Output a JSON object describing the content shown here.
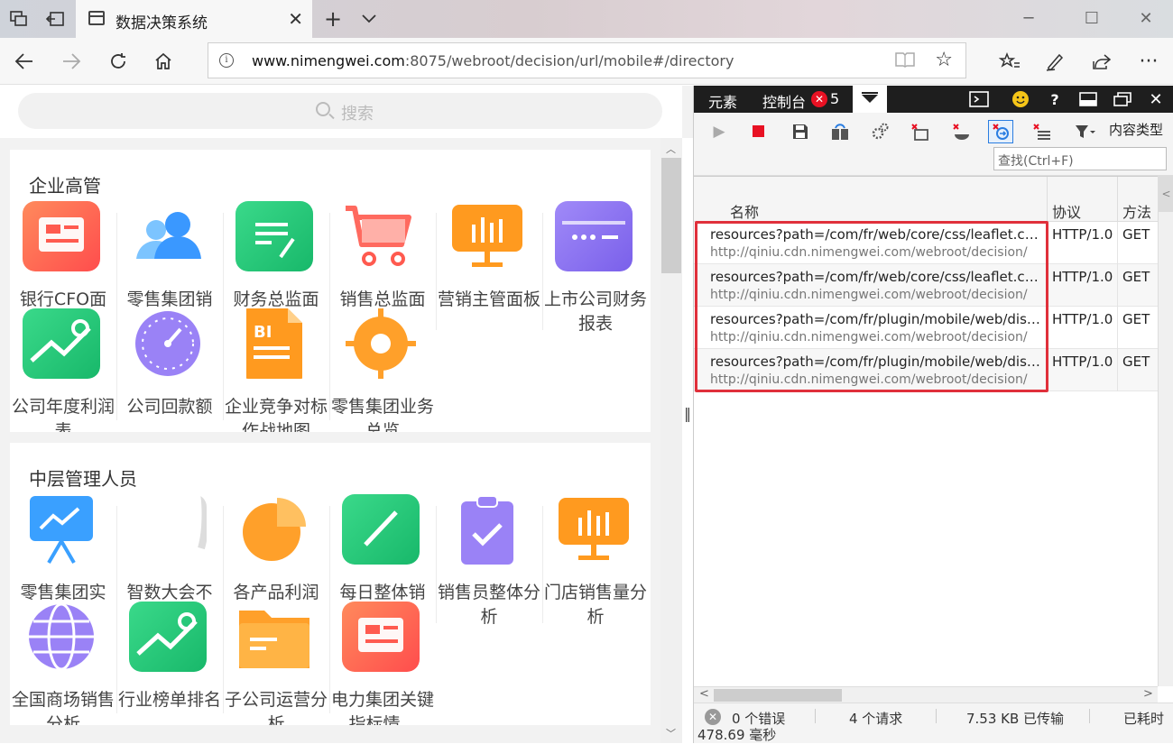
{
  "browser": {
    "tab_title": "数据决策系统",
    "url_host": "www.nimengwei.com",
    "url_rest": ":8075/webroot/decision/url/mobile#/directory"
  },
  "web": {
    "search_placeholder": "搜索",
    "sections": [
      {
        "title": "企业高管",
        "apps": [
          {
            "label": "银行CFO面",
            "icon": "id-card-icon",
            "color": "#ff6a4d"
          },
          {
            "label": "零售集团销",
            "icon": "users-icon",
            "color": "#3aa0ff"
          },
          {
            "label": "财务总监面",
            "icon": "document-edit-icon",
            "color": "#27c67a"
          },
          {
            "label": "销售总监面",
            "icon": "shopping-cart-icon",
            "color": "#ff5a4f"
          },
          {
            "label": "营销主管面板",
            "icon": "presentation-chart-icon",
            "color": "#ff9a1f"
          },
          {
            "label": "上市公司财务报表",
            "icon": "credit-card-icon",
            "color": "#8a70f0"
          },
          {
            "label": "公司年度利润表",
            "icon": "trend-chart-icon",
            "color": "#27c67a"
          },
          {
            "label": "公司回款额",
            "icon": "gauge-icon",
            "color": "#8a70f0"
          },
          {
            "label": "企业竞争对标作战地图",
            "icon": "bi-report-icon",
            "color": "#ff9a1f"
          },
          {
            "label": "零售集团业务总览",
            "icon": "location-target-icon",
            "color": "#ff9a1f"
          }
        ]
      },
      {
        "title": "中层管理人员",
        "apps": [
          {
            "label": "零售集团实",
            "icon": "easel-chart-icon",
            "color": "#3aa0ff"
          },
          {
            "label": "智数大会不完...",
            "icon": "blank-icon",
            "color": "#dddddd"
          },
          {
            "label": "各产品利润",
            "icon": "pie-chart-icon",
            "color": "#ff9a1f"
          },
          {
            "label": "每日整体销",
            "icon": "slash-tile-icon",
            "color": "#27c67a"
          },
          {
            "label": "销售员整体分析",
            "icon": "clipboard-check-icon",
            "color": "#8a70f0"
          },
          {
            "label": "门店销售量分析",
            "icon": "presentation-chart-icon",
            "color": "#ff9a1f"
          },
          {
            "label": "全国商场销售分析",
            "icon": "globe-icon",
            "color": "#8a70f0"
          },
          {
            "label": "行业榜单排名",
            "icon": "trend-chart-icon",
            "color": "#27c67a"
          },
          {
            "label": "子公司运营分析",
            "icon": "folder-icon",
            "color": "#ff9a1f"
          },
          {
            "label": "电力集团关键指标情...",
            "icon": "id-card-icon",
            "color": "#ff6a4d"
          }
        ]
      }
    ]
  },
  "devtools": {
    "tabs": {
      "elements": "元素",
      "console": "控制台",
      "error_count": "5"
    },
    "filter_label": "内容类型",
    "find_placeholder": "查找(Ctrl+F)",
    "columns": {
      "name": "名称",
      "protocol": "协议",
      "method": "方法"
    },
    "requests": [
      {
        "name": "resources?path=/com/fr/web/core/css/leaflet.css&...",
        "domain": "http://qiniu.cdn.nimengwei.com/webroot/decision/",
        "protocol": "HTTP/1.0",
        "method": "GET"
      },
      {
        "name": "resources?path=/com/fr/web/core/css/leaflet.css&...",
        "domain": "http://qiniu.cdn.nimengwei.com/webroot/decision/",
        "protocol": "HTTP/1.0",
        "method": "GET"
      },
      {
        "name": "resources?path=/com/fr/plugin/mobile/web/dist/js...",
        "domain": "http://qiniu.cdn.nimengwei.com/webroot/decision/",
        "protocol": "HTTP/1.0",
        "method": "GET"
      },
      {
        "name": "resources?path=/com/fr/plugin/mobile/web/dist/js...",
        "domain": "http://qiniu.cdn.nimengwei.com/webroot/decision/",
        "protocol": "HTTP/1.0",
        "method": "GET"
      }
    ],
    "status": {
      "errors": "0 个错误",
      "requests": "4 个请求",
      "transferred": "7.53 KB 已传输",
      "elapsed_label": "已耗时",
      "elapsed_value": "478.69 毫秒"
    }
  }
}
